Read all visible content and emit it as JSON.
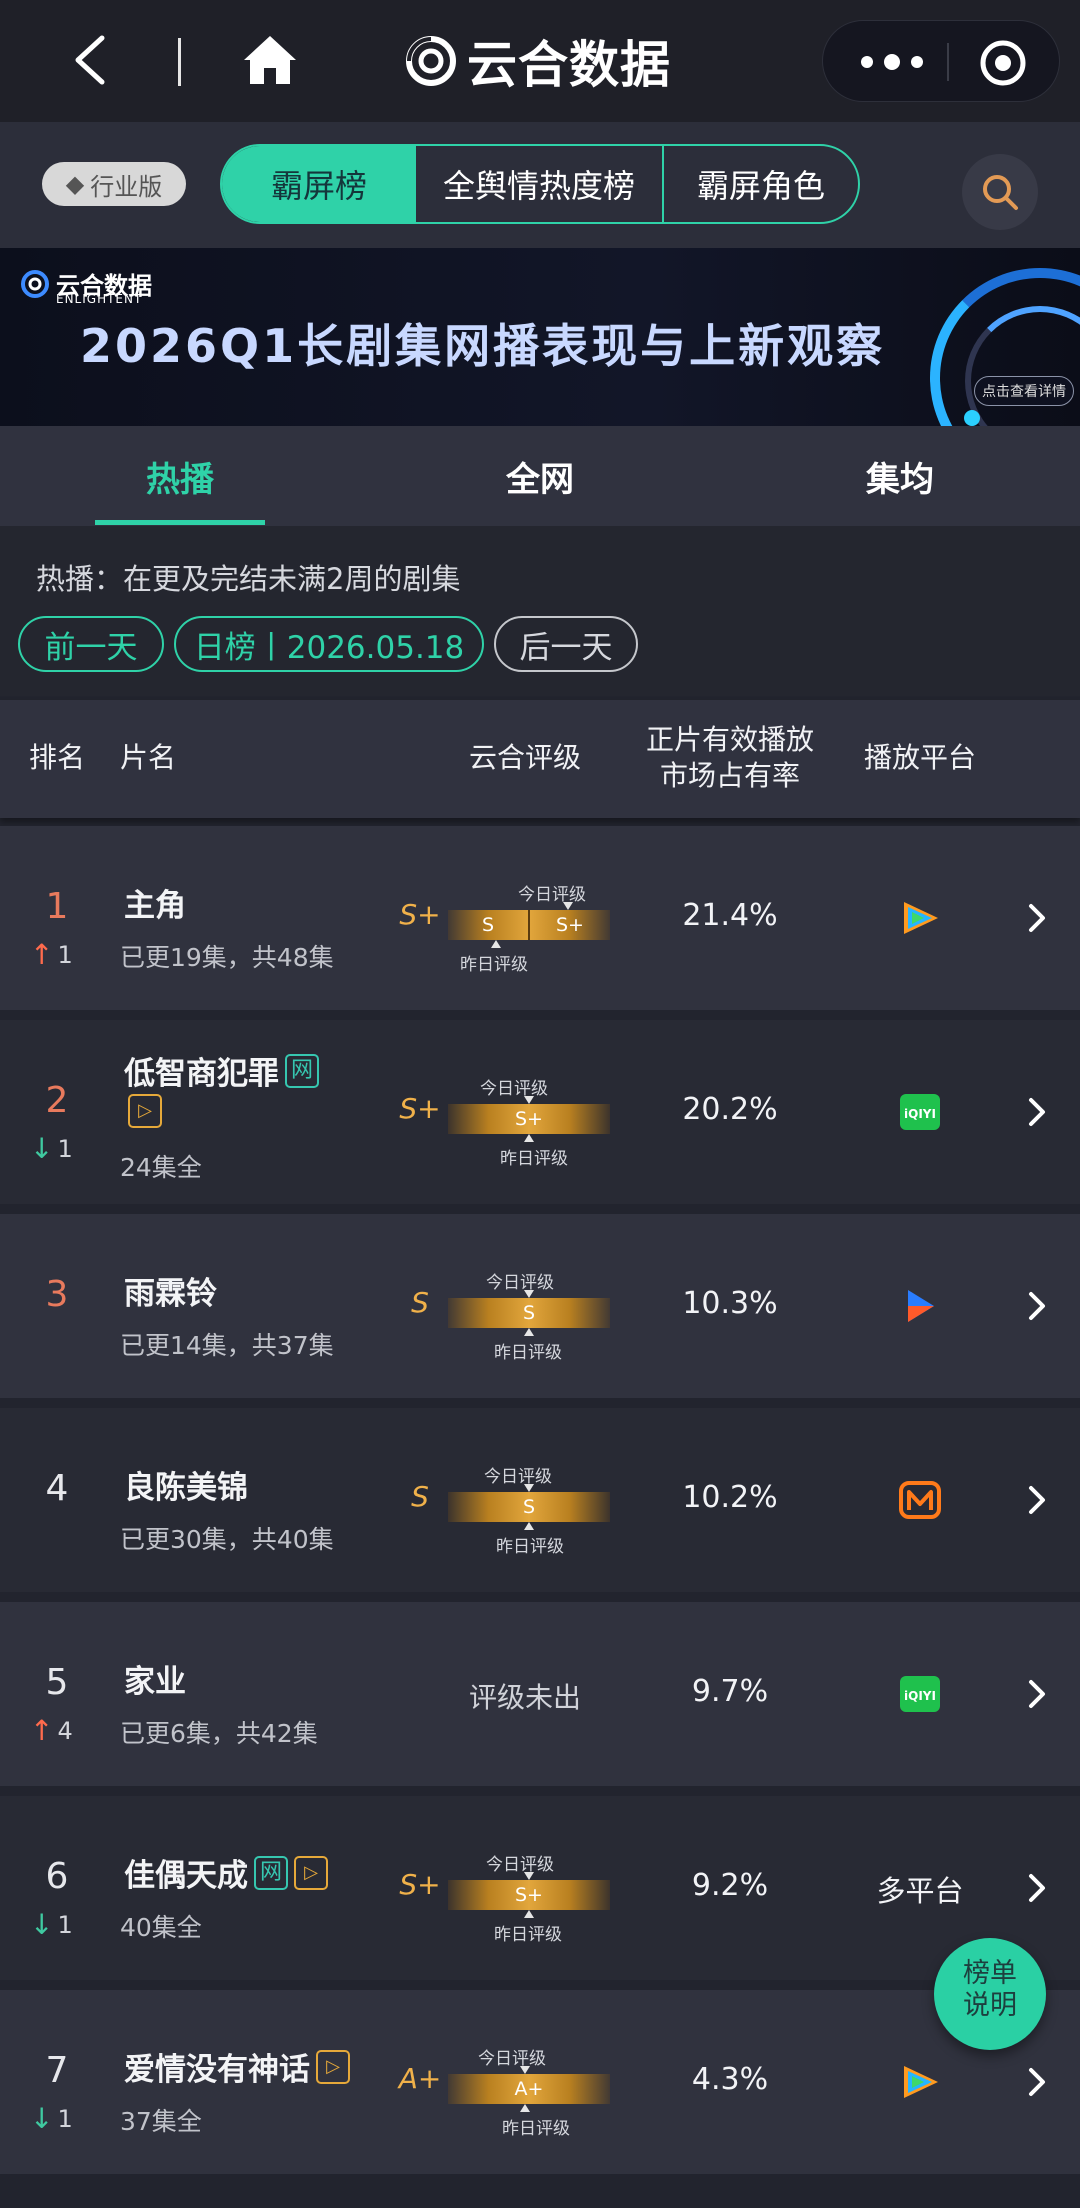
{
  "header": {
    "brand": "云合数据",
    "colors": {
      "accent": "#2fd2a8",
      "background": "#22242e"
    }
  },
  "toolbar": {
    "industry_label": "行业版",
    "segments": [
      "霸屏榜",
      "全舆情热度榜",
      "霸屏角色"
    ],
    "selected_segment": "霸屏榜"
  },
  "banner": {
    "logo_text": "云合数据",
    "logo_sub": "ENLIGHTENT",
    "title": "2026Q1长剧集网播表现与上新观察",
    "button": "点击查看详情"
  },
  "tabs": {
    "items": [
      "热播",
      "全网",
      "集均"
    ],
    "active": "热播"
  },
  "info": {
    "description": "热播：在更及完结未满2周的剧集",
    "prev_day": "前一天",
    "date_label": "日榜丨2026.05.18",
    "next_day": "后一天"
  },
  "table": {
    "headers": {
      "rank": "排名",
      "name": "片名",
      "grade": "云合评级",
      "share_line1": "正片有效播放",
      "share_line2": "市场占有率",
      "platform": "播放平台"
    },
    "labels": {
      "today": "今日评级",
      "yesterday": "昨日评级"
    },
    "rows": [
      {
        "rank": "1",
        "change_dir": "up",
        "change": "1",
        "title": "主角",
        "sub": "已更19集，共48集",
        "grade": "S+",
        "bar_left": "S",
        "bar_right": "S+",
        "share": "21.4%",
        "platform": "tencent-video-icon"
      },
      {
        "rank": "2",
        "change_dir": "down",
        "change": "1",
        "title": "低智商犯罪",
        "tag_net": "网",
        "tag_play": "▷",
        "sub": "24集全",
        "grade": "S+",
        "bar_center": "S+",
        "share": "20.2%",
        "platform": "iqiyi-icon"
      },
      {
        "rank": "3",
        "title": "雨霖铃",
        "sub": "已更14集，共37集",
        "grade": "S",
        "bar_center": "S",
        "share": "10.3%",
        "platform": "youku-icon"
      },
      {
        "rank": "4",
        "title": "良陈美锦",
        "sub": "已更30集，共40集",
        "grade": "S",
        "bar_center": "S",
        "share": "10.2%",
        "platform": "mango-tv-icon"
      },
      {
        "rank": "5",
        "change_dir": "up",
        "change": "4",
        "title": "家业",
        "sub": "已更6集，共42集",
        "no_grade": "评级未出",
        "share": "9.7%",
        "platform": "iqiyi-icon"
      },
      {
        "rank": "6",
        "change_dir": "down",
        "change": "1",
        "title": "佳偶天成",
        "tag_net": "网",
        "tag_play": "▷",
        "sub": "40集全",
        "grade": "S+",
        "bar_center": "S+",
        "share": "9.2%",
        "platform_text": "多平台"
      },
      {
        "rank": "7",
        "change_dir": "down",
        "change": "1",
        "title": "爱情没有神话",
        "tag_play": "▷",
        "sub": "37集全",
        "grade": "A+",
        "bar_center": "A+",
        "share": "4.3%",
        "platform": "tencent-video-icon"
      }
    ]
  },
  "fab": {
    "line1": "榜单",
    "line2": "说明"
  }
}
